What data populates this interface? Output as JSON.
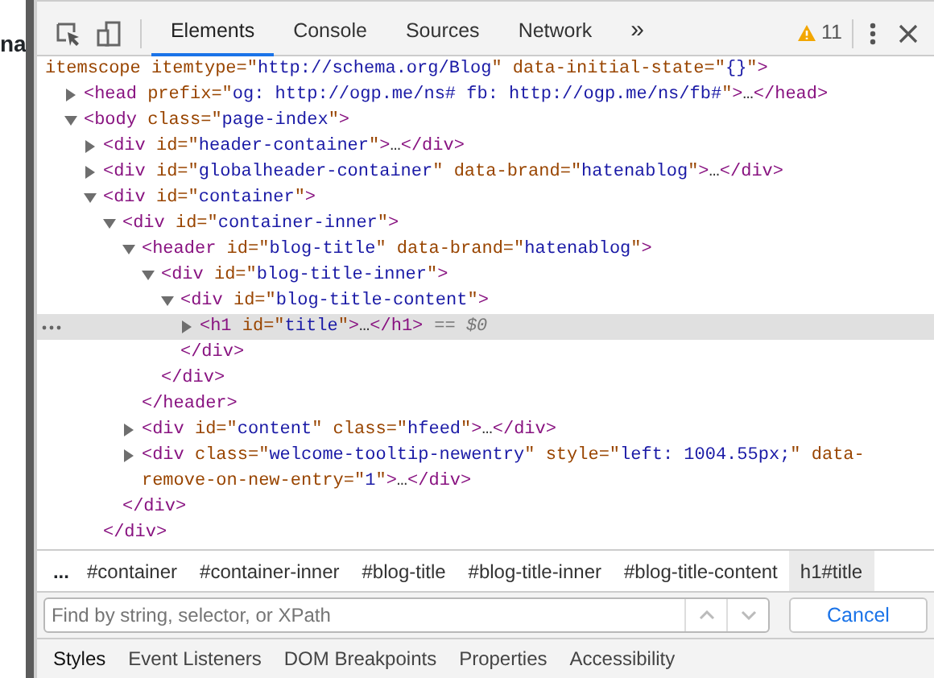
{
  "page_fragment": "na",
  "toolbar": {
    "tabs": [
      {
        "label": "Elements",
        "selected": true
      },
      {
        "label": "Console",
        "selected": false
      },
      {
        "label": "Sources",
        "selected": false
      },
      {
        "label": "Network",
        "selected": false
      }
    ],
    "more": "»",
    "warning_count": "11"
  },
  "tree": [
    {
      "selected": false,
      "tokens": [
        {
          "kind": "attr",
          "t": "itemscope itemtype=\""
        },
        {
          "kind": "value",
          "t": "http://schema.org/Blog"
        },
        {
          "kind": "attr",
          "t": "\" data-initial-state=\""
        },
        {
          "kind": "value",
          "t": "{}"
        },
        {
          "kind": "attr",
          "t": "\""
        },
        {
          "kind": "tag",
          "t": ">"
        }
      ],
      "children": [
        {
          "selected": false,
          "expanded": false,
          "tokens": [
            {
              "kind": "tag",
              "t": "<head"
            },
            {
              "kind": "attr",
              "t": " prefix=\""
            },
            {
              "kind": "value",
              "t": "og: http://ogp.me/ns# fb: http://ogp.me/ns/fb#"
            },
            {
              "kind": "attr",
              "t": "\""
            },
            {
              "kind": "tag",
              "t": ">"
            },
            {
              "kind": "plain",
              "t": "…"
            },
            {
              "kind": "tag",
              "t": "</head>"
            }
          ]
        },
        {
          "selected": false,
          "expanded": true,
          "tokens": [
            {
              "kind": "tag",
              "t": "<body"
            },
            {
              "kind": "attr",
              "t": " class=\""
            },
            {
              "kind": "value",
              "t": "page-index"
            },
            {
              "kind": "attr",
              "t": "\""
            },
            {
              "kind": "tag",
              "t": ">"
            }
          ],
          "children": [
            {
              "selected": false,
              "expanded": false,
              "tokens": [
                {
                  "kind": "tag",
                  "t": "<div"
                },
                {
                  "kind": "attr",
                  "t": " id=\""
                },
                {
                  "kind": "value",
                  "t": "header-container"
                },
                {
                  "kind": "attr",
                  "t": "\""
                },
                {
                  "kind": "tag",
                  "t": ">"
                },
                {
                  "kind": "plain",
                  "t": "…"
                },
                {
                  "kind": "tag",
                  "t": "</div>"
                }
              ]
            },
            {
              "selected": false,
              "expanded": false,
              "tokens": [
                {
                  "kind": "tag",
                  "t": "<div"
                },
                {
                  "kind": "attr",
                  "t": " id=\""
                },
                {
                  "kind": "value",
                  "t": "globalheader-container"
                },
                {
                  "kind": "attr",
                  "t": "\" data-brand=\""
                },
                {
                  "kind": "value",
                  "t": "hatenablog"
                },
                {
                  "kind": "attr",
                  "t": "\""
                },
                {
                  "kind": "tag",
                  "t": ">"
                },
                {
                  "kind": "plain",
                  "t": "…"
                },
                {
                  "kind": "tag",
                  "t": "</div>"
                }
              ]
            },
            {
              "selected": false,
              "expanded": true,
              "tokens": [
                {
                  "kind": "tag",
                  "t": "<div"
                },
                {
                  "kind": "attr",
                  "t": " id=\""
                },
                {
                  "kind": "value",
                  "t": "container"
                },
                {
                  "kind": "attr",
                  "t": "\""
                },
                {
                  "kind": "tag",
                  "t": ">"
                }
              ],
              "close": "</div>",
              "children": [
                {
                  "selected": false,
                  "expanded": true,
                  "tokens": [
                    {
                      "kind": "tag",
                      "t": "<div"
                    },
                    {
                      "kind": "attr",
                      "t": " id=\""
                    },
                    {
                      "kind": "value",
                      "t": "container-inner"
                    },
                    {
                      "kind": "attr",
                      "t": "\""
                    },
                    {
                      "kind": "tag",
                      "t": ">"
                    }
                  ],
                  "close": "</div>",
                  "children": [
                    {
                      "selected": false,
                      "expanded": true,
                      "tokens": [
                        {
                          "kind": "tag",
                          "t": "<header"
                        },
                        {
                          "kind": "attr",
                          "t": " id=\""
                        },
                        {
                          "kind": "value",
                          "t": "blog-title"
                        },
                        {
                          "kind": "attr",
                          "t": "\" data-brand=\""
                        },
                        {
                          "kind": "value",
                          "t": "hatenablog"
                        },
                        {
                          "kind": "attr",
                          "t": "\""
                        },
                        {
                          "kind": "tag",
                          "t": ">"
                        }
                      ],
                      "close": "</header>",
                      "children": [
                        {
                          "selected": false,
                          "expanded": true,
                          "tokens": [
                            {
                              "kind": "tag",
                              "t": "<div"
                            },
                            {
                              "kind": "attr",
                              "t": " id=\""
                            },
                            {
                              "kind": "value",
                              "t": "blog-title-inner"
                            },
                            {
                              "kind": "attr",
                              "t": "\""
                            },
                            {
                              "kind": "tag",
                              "t": ">"
                            }
                          ],
                          "close": "</div>",
                          "children": [
                            {
                              "selected": false,
                              "expanded": true,
                              "tokens": [
                                {
                                  "kind": "tag",
                                  "t": "<div"
                                },
                                {
                                  "kind": "attr",
                                  "t": " id=\""
                                },
                                {
                                  "kind": "value",
                                  "t": "blog-title-content"
                                },
                                {
                                  "kind": "attr",
                                  "t": "\""
                                },
                                {
                                  "kind": "tag",
                                  "t": ">"
                                }
                              ],
                              "close": "</div>",
                              "children": [
                                {
                                  "selected": true,
                                  "expanded": false,
                                  "tokens": [
                                    {
                                      "kind": "tag",
                                      "t": "<h1"
                                    },
                                    {
                                      "kind": "attr",
                                      "t": " id=\""
                                    },
                                    {
                                      "kind": "value",
                                      "t": "title"
                                    },
                                    {
                                      "kind": "attr",
                                      "t": "\""
                                    },
                                    {
                                      "kind": "tag",
                                      "t": ">"
                                    },
                                    {
                                      "kind": "plain",
                                      "t": "…"
                                    },
                                    {
                                      "kind": "tag",
                                      "t": "</h1>"
                                    }
                                  ],
                                  "suffix": "== $0"
                                }
                              ]
                            }
                          ]
                        }
                      ]
                    },
                    {
                      "selected": false,
                      "expanded": false,
                      "tokens": [
                        {
                          "kind": "tag",
                          "t": "<div"
                        },
                        {
                          "kind": "attr",
                          "t": " id=\""
                        },
                        {
                          "kind": "value",
                          "t": "content"
                        },
                        {
                          "kind": "attr",
                          "t": "\" class=\""
                        },
                        {
                          "kind": "value",
                          "t": "hfeed"
                        },
                        {
                          "kind": "attr",
                          "t": "\""
                        },
                        {
                          "kind": "tag",
                          "t": ">"
                        },
                        {
                          "kind": "plain",
                          "t": "…"
                        },
                        {
                          "kind": "tag",
                          "t": "</div>"
                        }
                      ]
                    },
                    {
                      "selected": false,
                      "expanded": false,
                      "tokens": [
                        {
                          "kind": "tag",
                          "t": "<div"
                        },
                        {
                          "kind": "attr",
                          "t": " class=\""
                        },
                        {
                          "kind": "value",
                          "t": "welcome-tooltip-newentry"
                        },
                        {
                          "kind": "attr",
                          "t": "\" style=\""
                        },
                        {
                          "kind": "value",
                          "t": "left: 1004.55px;"
                        },
                        {
                          "kind": "attr",
                          "t": "\" data-remove-on-new-entry=\""
                        },
                        {
                          "kind": "value",
                          "t": "1"
                        },
                        {
                          "kind": "attr",
                          "t": "\""
                        },
                        {
                          "kind": "tag",
                          "t": ">"
                        },
                        {
                          "kind": "plain",
                          "t": "…"
                        },
                        {
                          "kind": "tag",
                          "t": "</div>"
                        }
                      ]
                    }
                  ]
                }
              ]
            }
          ]
        }
      ]
    }
  ],
  "breadcrumbs": {
    "overflow": "...",
    "items": [
      {
        "label": "#container",
        "selected": false
      },
      {
        "label": "#container-inner",
        "selected": false
      },
      {
        "label": "#blog-title",
        "selected": false
      },
      {
        "label": "#blog-title-inner",
        "selected": false
      },
      {
        "label": "#blog-title-content",
        "selected": false
      },
      {
        "label": "h1#title",
        "selected": true
      }
    ]
  },
  "search": {
    "placeholder": "Find by string, selector, or XPath",
    "cancel": "Cancel"
  },
  "bottom_tabs": [
    {
      "label": "Styles",
      "selected": true
    },
    {
      "label": "Event Listeners",
      "selected": false
    },
    {
      "label": "DOM Breakpoints",
      "selected": false
    },
    {
      "label": "Properties",
      "selected": false
    },
    {
      "label": "Accessibility",
      "selected": false
    }
  ]
}
